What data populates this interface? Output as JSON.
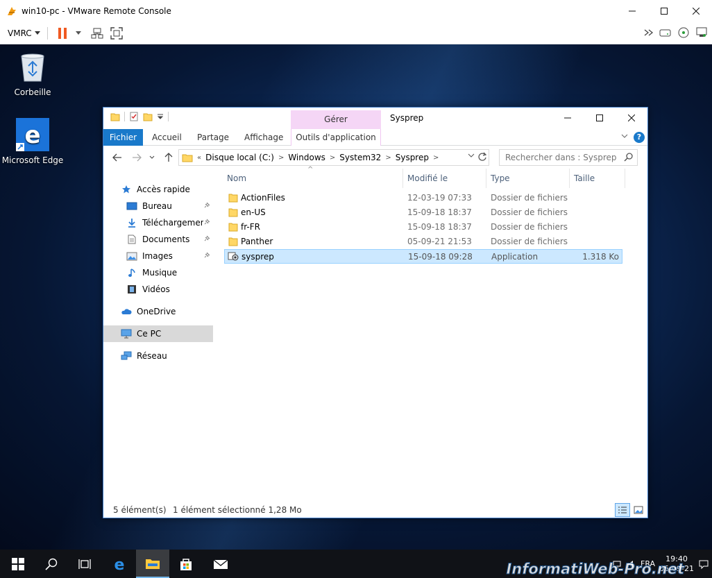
{
  "vmrc": {
    "title": "win10-pc - VMware Remote Console",
    "menu_label": "VMRC"
  },
  "desktop": {
    "icons": [
      {
        "label": "Corbeille"
      },
      {
        "label": "Microsoft Edge"
      }
    ]
  },
  "explorer": {
    "title": "Sysprep",
    "contextual_tab": "Gérer",
    "tabs": {
      "file": "Fichier",
      "home": "Accueil",
      "share": "Partage",
      "view": "Affichage",
      "app_tools": "Outils d'application"
    },
    "address": {
      "prefix": "«",
      "crumbs": [
        "Disque local (C:)",
        "Windows",
        "System32",
        "Sysprep"
      ]
    },
    "search": {
      "placeholder": "Rechercher dans : Sysprep"
    },
    "nav": {
      "quick_access": "Accès rapide",
      "items": [
        {
          "label": "Bureau"
        },
        {
          "label": "Téléchargements"
        },
        {
          "label": "Documents"
        },
        {
          "label": "Images"
        },
        {
          "label": "Musique"
        },
        {
          "label": "Vidéos"
        }
      ],
      "onedrive": "OneDrive",
      "this_pc": "Ce PC",
      "network": "Réseau"
    },
    "columns": {
      "name": "Nom",
      "modified": "Modifié le",
      "type": "Type",
      "size": "Taille"
    },
    "files": [
      {
        "name": "ActionFiles",
        "modified": "12-03-19 07:33",
        "type": "Dossier de fichiers",
        "size": ""
      },
      {
        "name": "en-US",
        "modified": "15-09-18 18:37",
        "type": "Dossier de fichiers",
        "size": ""
      },
      {
        "name": "fr-FR",
        "modified": "15-09-18 18:37",
        "type": "Dossier de fichiers",
        "size": ""
      },
      {
        "name": "Panther",
        "modified": "05-09-21 21:53",
        "type": "Dossier de fichiers",
        "size": ""
      },
      {
        "name": "sysprep",
        "modified": "15-09-18 09:28",
        "type": "Application",
        "size": "1.318 Ko"
      }
    ],
    "status": {
      "count": "5 élément(s)",
      "selection": "1 élément sélectionné  1,28 Mo"
    }
  },
  "taskbar": {
    "lang": "FRA",
    "time": "19:40",
    "date": "05-09-21"
  },
  "watermark": "InformatiWeb-Pro.net",
  "colors": {
    "accent": "#1979ca",
    "selection": "#cce8ff",
    "contextual": "#f5d6f6"
  }
}
